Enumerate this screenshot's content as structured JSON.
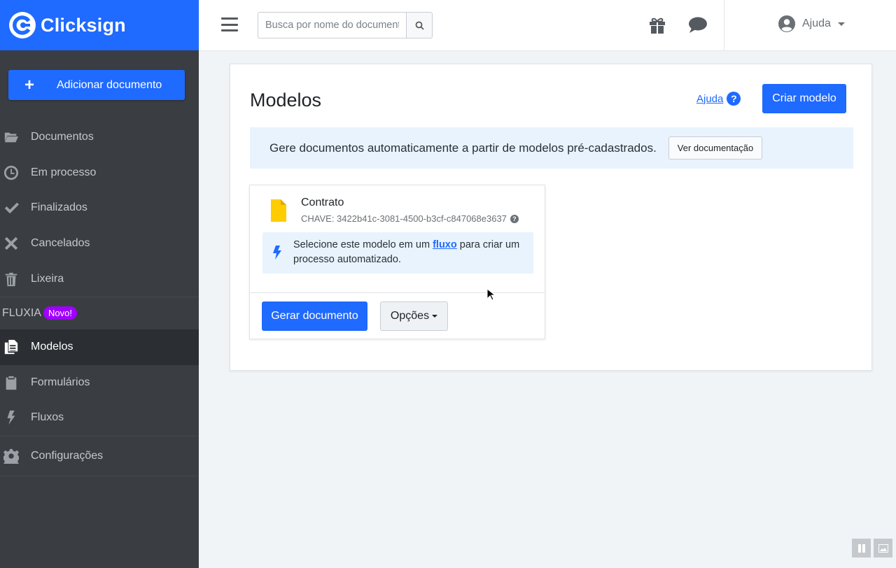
{
  "brand": {
    "name": "Clicksign",
    "color": "#1f6aff"
  },
  "sidebar": {
    "add_document_label": "Adicionar documento",
    "items": [
      {
        "label": "Documentos",
        "icon": "folder-open-icon"
      },
      {
        "label": "Em processo",
        "icon": "clock-icon"
      },
      {
        "label": "Finalizados",
        "icon": "check-icon"
      },
      {
        "label": "Cancelados",
        "icon": "x-icon"
      },
      {
        "label": "Lixeira",
        "icon": "trash-icon"
      }
    ],
    "fluxia": {
      "label": "FLUXIA",
      "badge": "Novo!"
    },
    "fluxia_items": [
      {
        "label": "Modelos",
        "icon": "copy-docs-icon",
        "active": true
      },
      {
        "label": "Formulários",
        "icon": "clipboard-icon"
      },
      {
        "label": "Fluxos",
        "icon": "bolt-icon"
      }
    ],
    "settings_label": "Configurações"
  },
  "topbar": {
    "search_placeholder": "Busca por nome do documento",
    "user_label": "Ajuda"
  },
  "main": {
    "title": "Modelos",
    "help_label": "Ajuda",
    "create_button": "Criar modelo",
    "info_text": "Gere documentos automaticamente a partir de modelos pré-cadastrados.",
    "docs_button": "Ver documentação",
    "template": {
      "name": "Contrato",
      "key": "CHAVE: 3422b41c-3081-4500-b3cf-c847068e3637",
      "flow_text_before": "Selecione este modelo em um",
      "flow_link": "fluxo",
      "flow_text_after": "para criar um processo automatizado.",
      "generate_button": "Gerar documento",
      "options_button": "Opções"
    }
  }
}
